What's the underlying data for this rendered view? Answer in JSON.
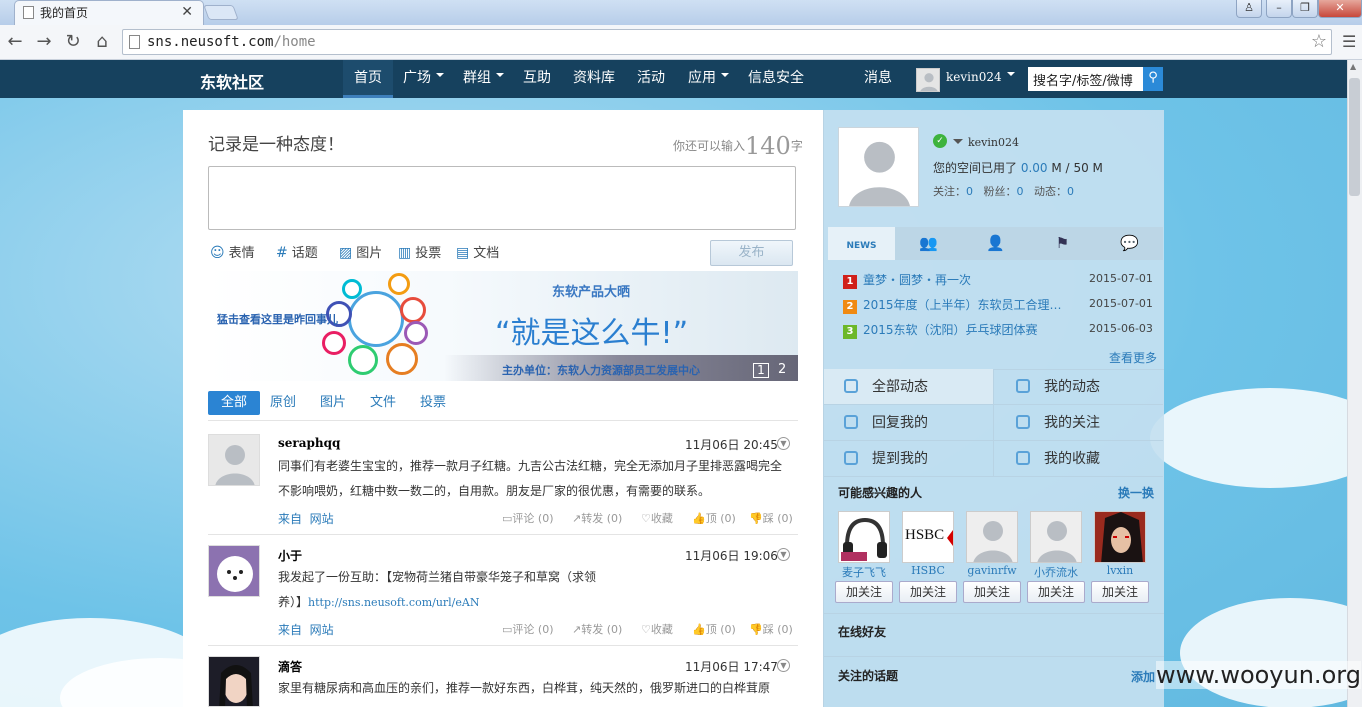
{
  "browser": {
    "tab_title": "我的首页",
    "url_host": "sns.neusoft.com",
    "url_path": "/home"
  },
  "site": {
    "logo": "东软社区",
    "nav": [
      {
        "label": "首页"
      },
      {
        "label": "广场"
      },
      {
        "label": "群组"
      },
      {
        "label": "互助"
      },
      {
        "label": "资料库"
      },
      {
        "label": "活动"
      },
      {
        "label": "应用"
      },
      {
        "label": "信息安全"
      }
    ],
    "messages": "消息",
    "username": "kevin024",
    "search_value": "搜名字/标签/微博"
  },
  "composer": {
    "title": "记录是一种态度！",
    "counter_prefix": "你还可以输入",
    "counter_value": "140",
    "counter_suffix": "字",
    "tools": [
      "表情",
      "话题",
      "图片",
      "投票",
      "文档"
    ],
    "publish": "发布"
  },
  "banner": {
    "left_link": "猛击查看这里是昨回事儿",
    "title": "东软产品大晒",
    "slogan": "“就是这么牛!”",
    "footer": "主办单位：东软人力资源部员工发展中心",
    "page1": "1",
    "page2": "2"
  },
  "feed_tabs": [
    "全部",
    "原创",
    "图片",
    "文件",
    "投票"
  ],
  "feed": [
    {
      "name": "seraphqq",
      "time": "11月06日 20:45",
      "line1": "同事们有老婆生宝宝的，推荐一款月子红糖。九吉公古法红糖，完全无添加月子里排恶露喝完全",
      "line2": "不影响喂奶，红糖中数一数二的，自用款。朋友是厂家的很优惠，有需要的联系。",
      "link": "",
      "src_prefix": "来自",
      "src": "网站",
      "actions": [
        "评论 (0)",
        "转发 (0)",
        "收藏",
        "顶 (0)",
        "踩 (0)"
      ]
    },
    {
      "name": "小于",
      "time": "11月06日 19:06",
      "line1": "我发起了一份互助：【宠物荷兰猪自带豪华笼子和草窝（求领",
      "line2": "养）】",
      "link": "http://sns.neusoft.com/url/eAN",
      "src_prefix": "来自",
      "src": "网站",
      "actions": [
        "评论 (0)",
        "转发 (0)",
        "收藏",
        "顶 (0)",
        "踩 (0)"
      ]
    },
    {
      "name": "滴答",
      "time": "11月06日 17:47",
      "line1": "家里有糖尿病和高血压的亲们，推荐一款好东西，白桦茸，纯天然的，俄罗斯进口的白桦茸原",
      "line2": "",
      "link": "",
      "src_prefix": "",
      "src": "",
      "actions": []
    }
  ],
  "profile": {
    "name": "kevin024",
    "space_prefix": "您的空间已用了",
    "space_used": "0.00",
    "space_mid": "M /",
    "space_total": "50",
    "space_unit": "M",
    "stats": [
      {
        "label": "关注：",
        "value": "0"
      },
      {
        "label": "粉丝：",
        "value": "0"
      },
      {
        "label": "动态：",
        "value": "0"
      }
    ]
  },
  "news_tab_label": "NEWS",
  "news": [
    {
      "rank": "1",
      "title": "童梦・圆梦・再一次",
      "date": "2015-07-01",
      "color": "#d0201a"
    },
    {
      "rank": "2",
      "title": "2015年度（上半年）东软员工合理…",
      "date": "2015-07-01",
      "color": "#f08a12"
    },
    {
      "rank": "3",
      "title": "2015东软（沈阳）乒乓球团体赛",
      "date": "2015-06-03",
      "color": "#6cb82a"
    }
  ],
  "news_more": "查看更多",
  "menu": [
    {
      "label": "全部动态"
    },
    {
      "label": "我的动态"
    },
    {
      "label": "回复我的"
    },
    {
      "label": "我的关注"
    },
    {
      "label": "提到我的"
    },
    {
      "label": "我的收藏"
    }
  ],
  "suggest": {
    "title": "可能感兴趣的人",
    "swap": "换一换",
    "people": [
      {
        "name": "麦子飞飞"
      },
      {
        "name": "HSBC"
      },
      {
        "name": "gavinrfw"
      },
      {
        "name": "小乔流水"
      },
      {
        "name": "lvxin"
      }
    ],
    "follow_label": "加关注",
    "hsbc_logo": "HSBC"
  },
  "online_title": "在线好友",
  "topics_title": "关注的话题",
  "topics_add": "添加",
  "watermark": "www.wooyun.org"
}
